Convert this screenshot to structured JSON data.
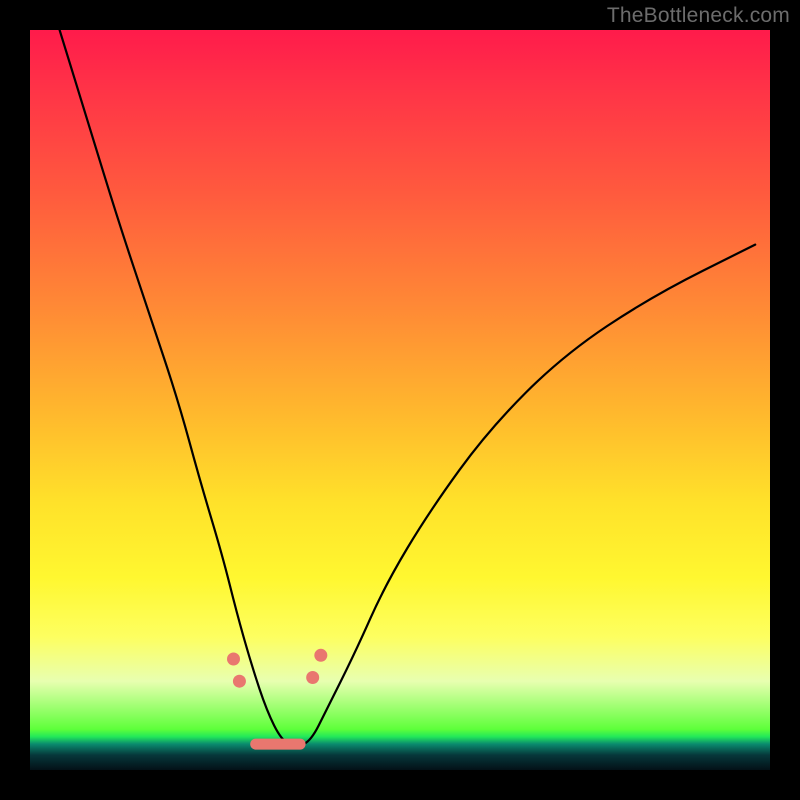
{
  "attribution": "TheBottleneck.com",
  "chart_data": {
    "type": "line",
    "title": "",
    "xlabel": "",
    "ylabel": "",
    "xlim": [
      0,
      100
    ],
    "ylim": [
      0,
      100
    ],
    "background": {
      "style": "vertical-gradient",
      "stops": [
        {
          "pos": 0,
          "color": "#ff1b4b"
        },
        {
          "pos": 22,
          "color": "#ff5a3e"
        },
        {
          "pos": 52,
          "color": "#ffb92d"
        },
        {
          "pos": 74,
          "color": "#fff730"
        },
        {
          "pos": 94,
          "color": "#5eff3a"
        },
        {
          "pos": 100,
          "color": "#031017"
        }
      ]
    },
    "series": [
      {
        "name": "bottleneck-curve",
        "color": "#000000",
        "x": [
          4,
          8,
          12,
          16,
          20,
          23,
          26,
          28,
          30,
          32,
          34,
          36,
          38,
          40,
          44,
          48,
          54,
          62,
          72,
          84,
          98
        ],
        "y": [
          100,
          87,
          74,
          62,
          50,
          39,
          29,
          21,
          14,
          8,
          4,
          3,
          4,
          8,
          16,
          25,
          35,
          46,
          56,
          64,
          71
        ]
      }
    ],
    "markers": {
      "color": "#e9776f",
      "points": [
        {
          "x": 27.5,
          "y": 15
        },
        {
          "x": 28.3,
          "y": 12
        },
        {
          "x": 38.2,
          "y": 12.5
        },
        {
          "x": 39.3,
          "y": 15.5
        }
      ],
      "flat_segment": {
        "x0": 30.5,
        "x1": 36.5,
        "y": 3.5
      }
    }
  }
}
